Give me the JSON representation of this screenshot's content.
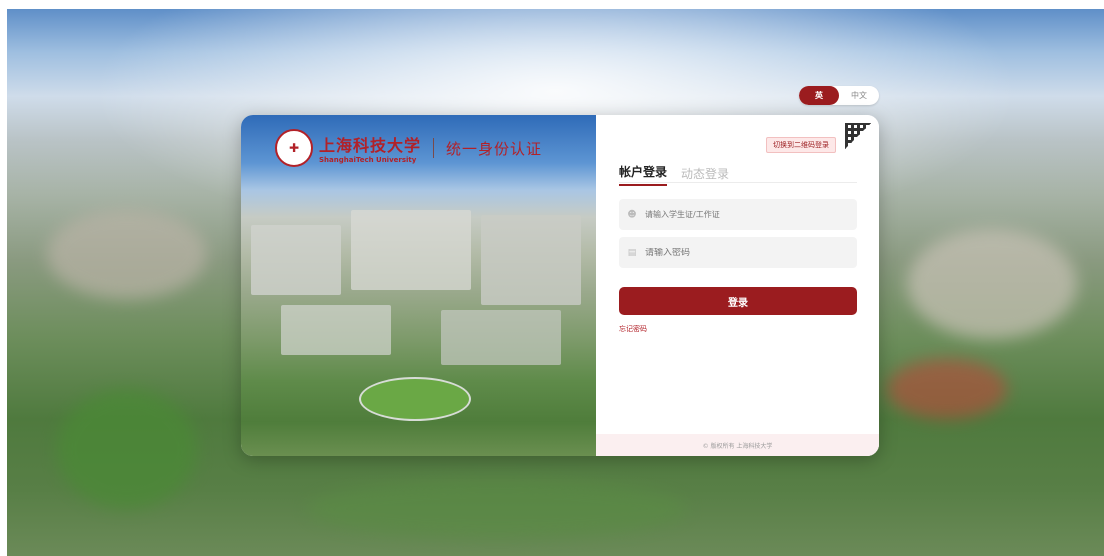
{
  "language_toggle": {
    "active": "英",
    "inactive": "中文"
  },
  "brand": {
    "seal_glyph": "✚",
    "name_cn": "上海科技大学",
    "name_en": "ShanghaiTech University",
    "subtitle": "统一身份认证"
  },
  "login": {
    "qr_tip": "切换到二维码登录",
    "tabs": [
      {
        "label": "帐户登录",
        "active": true
      },
      {
        "label": "动态登录",
        "active": false
      }
    ],
    "username_placeholder": "请输入学生证/工作证",
    "password_placeholder": "请输入密码",
    "submit_label": "登录",
    "forgot_label": "忘记密码",
    "footer": "© 版权所有 上海科技大学"
  },
  "colors": {
    "accent": "#9b1c1f",
    "brand_red": "#b22128"
  }
}
